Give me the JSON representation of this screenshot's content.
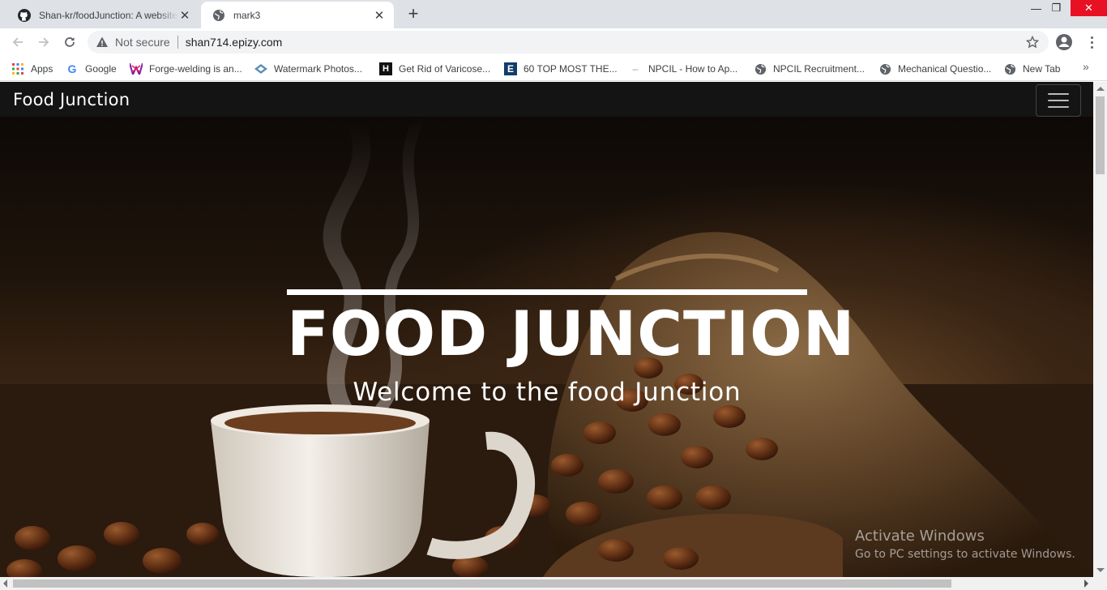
{
  "browser": {
    "tabs": [
      {
        "title": "Shan-kr/foodJunction: A website",
        "icon": "github-icon",
        "active": false
      },
      {
        "title": "mark3",
        "icon": "globe-icon",
        "active": true
      }
    ],
    "new_tab": "+",
    "address": {
      "security": "Not secure",
      "url": "shan714.epizy.com"
    },
    "window": {
      "minimize": "—",
      "restore": "❐",
      "close": "✕"
    },
    "bookmarks": [
      {
        "label": "Apps",
        "icon": "apps-grid-icon"
      },
      {
        "label": "Google",
        "icon": "google-icon"
      },
      {
        "label": "Forge-welding is an...",
        "icon": "forge-site-icon"
      },
      {
        "label": "Watermark Photos...",
        "icon": "watermark-site-icon"
      },
      {
        "label": "Get Rid of Varicose...",
        "icon": "hashtag-site-icon"
      },
      {
        "label": "60 TOP MOST THE...",
        "icon": "e-site-icon"
      },
      {
        "label": "NPCIL - How to Ap...",
        "icon": "dash-site-icon"
      },
      {
        "label": "NPCIL Recruitment...",
        "icon": "globe-icon"
      },
      {
        "label": "Mechanical Questio...",
        "icon": "globe-icon"
      },
      {
        "label": "New Tab",
        "icon": "globe-icon"
      }
    ],
    "bookmarks_more": "»"
  },
  "site": {
    "brand": "Food Junction",
    "hero": {
      "title": "FOOD JUNCTION",
      "subtitle": "Welcome to the food Junction"
    }
  },
  "os_watermark": {
    "line1": "Activate Windows",
    "line2": "Go to PC settings to activate Windows."
  }
}
